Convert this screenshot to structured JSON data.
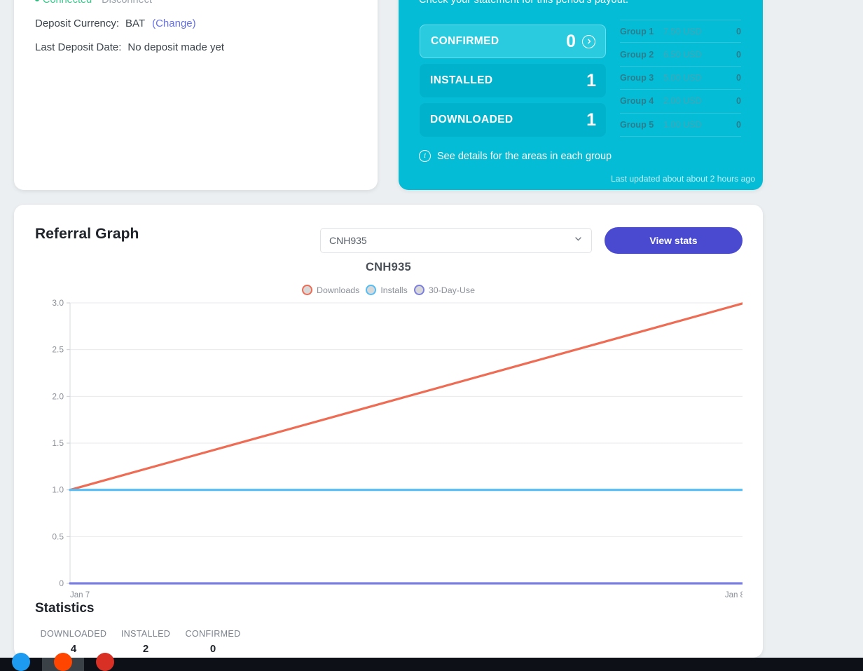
{
  "account": {
    "connection_status": "Connected",
    "disconnect_label": "Disconnect",
    "deposit_currency_label": "Deposit Currency:",
    "deposit_currency_value": "BAT",
    "change_link": "(Change)",
    "last_deposit_label": "Last Deposit Date:",
    "last_deposit_value": "No deposit made yet",
    "status_color": "#37c98a",
    "link_color": "#6672e8"
  },
  "payout": {
    "heading": "Check your statement for this period's payout.",
    "panel_color": "#05bcd6",
    "stats": [
      {
        "label": "CONFIRMED",
        "value": "0",
        "active": true,
        "has_chevron": true
      },
      {
        "label": "INSTALLED",
        "value": "1",
        "active": false,
        "has_chevron": false
      },
      {
        "label": "DOWNLOADED",
        "value": "1",
        "active": false,
        "has_chevron": false
      }
    ],
    "groups": [
      {
        "name": "Group 1",
        "amount": "7.50 USD",
        "count": "0"
      },
      {
        "name": "Group 2",
        "amount": "6.50 USD",
        "count": "0"
      },
      {
        "name": "Group 3",
        "amount": "5.00 USD",
        "count": "0"
      },
      {
        "name": "Group 4",
        "amount": "2.00 USD",
        "count": "0"
      },
      {
        "name": "Group 5",
        "amount": "1.00 USD",
        "count": "0"
      }
    ],
    "see_details": "See details for the areas in each group",
    "info_icon": "info-circle-icon",
    "last_updated": "Last updated about about 2 hours ago"
  },
  "graph": {
    "title": "Referral Graph",
    "select_value": "CNH935",
    "select_icon": "chevron-down-icon",
    "view_stats_label": "View stats",
    "view_stats_color": "#4a4ad1"
  },
  "chart_data": {
    "type": "line",
    "title": "CNH935",
    "xlabel": "",
    "ylabel": "",
    "x": [
      "Jan 7",
      "Jan 8"
    ],
    "xticklabels": [
      "Jan 7",
      "Jan 8"
    ],
    "yticklabels": [
      "0",
      "0.5",
      "1.0",
      "1.5",
      "2.0",
      "2.5",
      "3.0"
    ],
    "yticks": [
      0,
      0.5,
      1.0,
      1.5,
      2.0,
      2.5,
      3.0
    ],
    "ylim": [
      0,
      3.0
    ],
    "grid": true,
    "legend_position": "top-center",
    "series": [
      {
        "name": "Downloads",
        "values": [
          1,
          3
        ],
        "color": "#ef6c54"
      },
      {
        "name": "Installs",
        "values": [
          1,
          1
        ],
        "color": "#54bdf5"
      },
      {
        "name": "30-Day-Use",
        "values": [
          0,
          0
        ],
        "color": "#7b7fe0"
      }
    ],
    "legend_dot_fill": "#d8d8d8"
  },
  "statistics": {
    "heading": "Statistics",
    "cells": [
      {
        "label": "DOWNLOADED",
        "value": "4"
      },
      {
        "label": "INSTALLED",
        "value": "2"
      },
      {
        "label": "CONFIRMED",
        "value": "0"
      }
    ]
  },
  "taskbar": {
    "items": [
      {
        "name": "taskbar-app-1",
        "color": "#1d9bf0",
        "active": false
      },
      {
        "name": "taskbar-app-2",
        "color": "#ff4500",
        "active": true
      },
      {
        "name": "taskbar-app-3",
        "color": "#d93025",
        "active": false
      }
    ]
  }
}
